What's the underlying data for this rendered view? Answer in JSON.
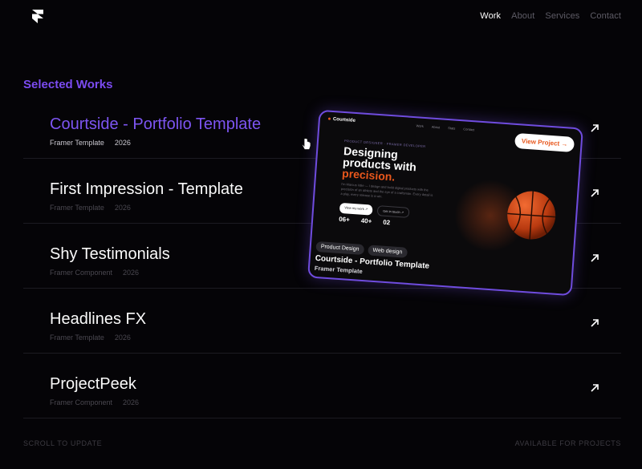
{
  "nav": {
    "items": [
      {
        "label": "Work",
        "active": true
      },
      {
        "label": "About",
        "active": false
      },
      {
        "label": "Services",
        "active": false
      },
      {
        "label": "Contact",
        "active": false
      }
    ]
  },
  "section_title": "Selected Works",
  "projects": [
    {
      "title": "Courtside - Portfolio Template",
      "type": "Framer Template",
      "year": "2026"
    },
    {
      "title": "First Impression - Template",
      "type": "Framer Template",
      "year": "2026"
    },
    {
      "title": "Shy Testimonials",
      "type": "Framer Component",
      "year": "2026"
    },
    {
      "title": "Headlines FX",
      "type": "Framer Template",
      "year": "2026"
    },
    {
      "title": "ProjectPeek",
      "type": "Framer Component",
      "year": "2026"
    }
  ],
  "footer": {
    "left": "SCROLL TO UPDATE",
    "right": "AVAILABLE FOR PROJECTS"
  },
  "preview": {
    "brand": "Courtside",
    "nav_links": [
      "Work",
      "About",
      "Stats",
      "Contact"
    ],
    "eyebrow": "PRODUCT DESIGNER · FRAMER DEVELOPER",
    "headline_1": "Designing",
    "headline_2": "products with",
    "headline_accent": "precision.",
    "body": "I'm Marcus Vale — I design and build digital products with the precision of an athlete and the eye of a craftsman. Every detail is a play, every release is a win.",
    "btn_primary": "View my work ↗",
    "btn_secondary": "Get in touch ↗",
    "stats": [
      "06+",
      "40+",
      "02"
    ],
    "tags": [
      "Product Design",
      "Web design"
    ],
    "title": "Courtside - Portfolio Template",
    "subtitle": "Framer Template",
    "view_button": "View Project →"
  },
  "colors": {
    "accent_purple": "#7b4bf0",
    "accent_orange": "#e8571c",
    "background": "#050407"
  }
}
